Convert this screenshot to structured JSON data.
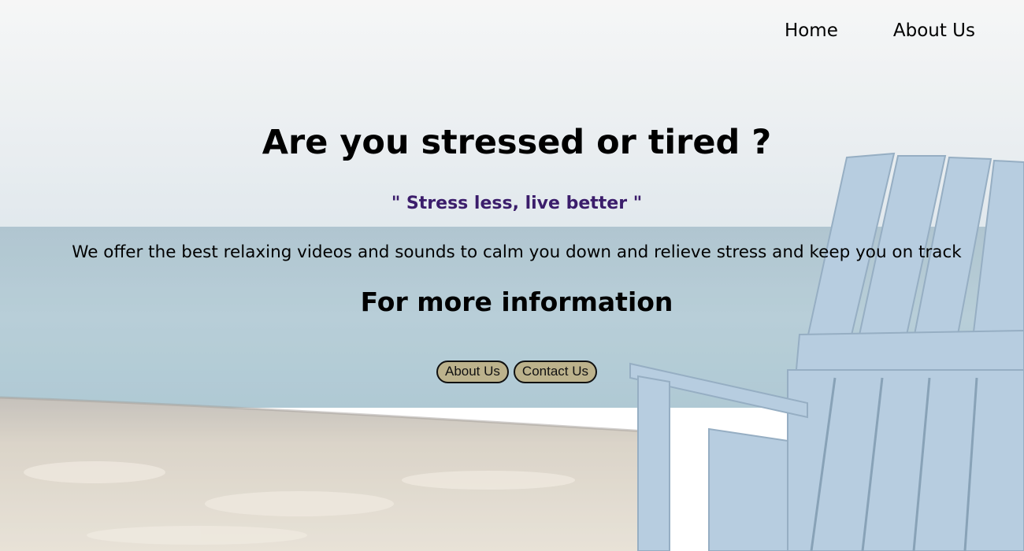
{
  "nav": {
    "items": [
      {
        "label": "Home"
      },
      {
        "label": "About Us"
      }
    ]
  },
  "hero": {
    "title": "Are you stressed or tired ?",
    "quote": "\" Stress less, live better \"",
    "description": "We offer the best relaxing videos and sounds to calm you down and relieve stress and keep you on track",
    "cta_heading": "For more information",
    "buttons": [
      {
        "label": "About Us"
      },
      {
        "label": "Contact Us"
      }
    ]
  },
  "colors": {
    "quote": "#3b1d6b",
    "button_bg": "#bcb28c",
    "sky": "#e7ecef",
    "sea": "#9bb9c7",
    "sand": "#d9d2c6",
    "chair": "#a9c4dc"
  }
}
